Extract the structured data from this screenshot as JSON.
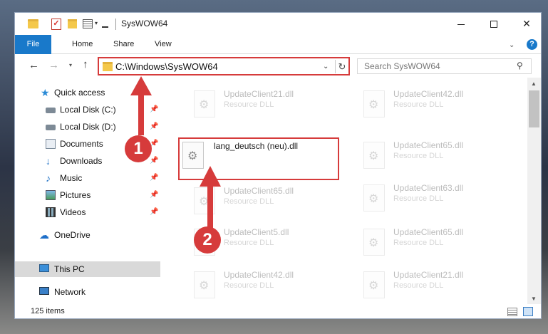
{
  "window": {
    "title": "SysWOW64",
    "controls": {
      "minimize_icon": "minimize-icon",
      "maximize_icon": "maximize-icon",
      "close_icon": "close-icon"
    }
  },
  "ribbon": {
    "tabs": [
      "File",
      "Home",
      "Share",
      "View"
    ],
    "help": "?"
  },
  "navigation": {
    "address": "C:\\Windows\\SysWOW64",
    "search_placeholder": "Search SysWOW64"
  },
  "sidebar": {
    "items": [
      {
        "label": "Quick access",
        "icon": "star-icon",
        "pinned": false
      },
      {
        "label": "Local Disk (C:)",
        "icon": "disk-icon",
        "pinned": true
      },
      {
        "label": "Local Disk (D:)",
        "icon": "disk-icon",
        "pinned": true
      },
      {
        "label": "Documents",
        "icon": "document-icon",
        "pinned": true
      },
      {
        "label": "Downloads",
        "icon": "download-icon",
        "pinned": true
      },
      {
        "label": "Music",
        "icon": "music-icon",
        "pinned": true
      },
      {
        "label": "Pictures",
        "icon": "pictures-icon",
        "pinned": true
      },
      {
        "label": "Videos",
        "icon": "videos-icon",
        "pinned": true
      },
      {
        "label": "OneDrive",
        "icon": "cloud-icon",
        "pinned": false
      },
      {
        "label": "This PC",
        "icon": "computer-icon",
        "pinned": false,
        "selected": true
      },
      {
        "label": "Network",
        "icon": "network-icon",
        "pinned": false
      }
    ]
  },
  "files": {
    "left_column": [
      {
        "name": "UpdateClient21.dll",
        "type": "Resource DLL"
      },
      {
        "name": "lang_deutsch (neu).dll",
        "type": "",
        "highlighted": true
      },
      {
        "name": "UpdateClient65.dll",
        "type": "Resource DLL"
      },
      {
        "name": "UpdateClient5.dll",
        "type": "Resource DLL"
      },
      {
        "name": "UpdateClient42.dll",
        "type": "Resource DLL"
      }
    ],
    "right_column": [
      {
        "name": "UpdateClient42.dll",
        "type": "Resource DLL"
      },
      {
        "name": "UpdateClient65.dll",
        "type": "Resource DLL"
      },
      {
        "name": "UpdateClient63.dll",
        "type": "Resource DLL"
      },
      {
        "name": "UpdateClient65.dll",
        "type": "Resource DLL"
      },
      {
        "name": "UpdateClient21.dll",
        "type": "Resource DLL"
      }
    ]
  },
  "status": {
    "item_count": "125 items"
  },
  "annotations": {
    "step1": "1",
    "step2": "2",
    "accent_color": "#d63b3b"
  }
}
